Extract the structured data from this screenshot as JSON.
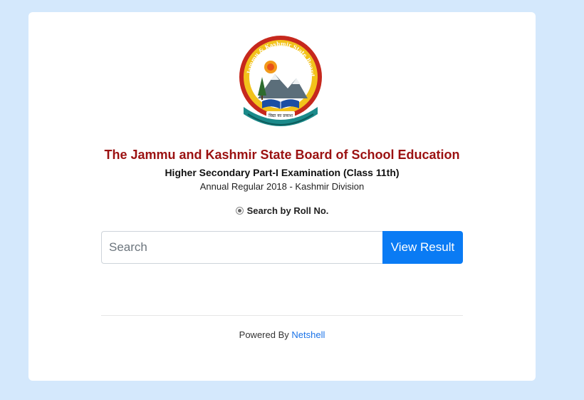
{
  "header": {
    "logo_text_top": "Jammu & Kashmir State Board Of School Education",
    "logo_motto": "विद्या का प्रकाश",
    "title": "The Jammu and Kashmir State Board of School Education",
    "exam": "Higher Secondary Part-I Examination (Class 11th)",
    "session": "Annual Regular 2018 - Kashmir Division"
  },
  "search": {
    "radio_label": "Search by Roll No.",
    "placeholder": "Search",
    "value": "",
    "button_label": "View Result"
  },
  "footer": {
    "powered_by": "Powered By",
    "link_text": "Netshell"
  },
  "colors": {
    "background": "#d4e8fc",
    "title": "#9b1111",
    "button": "#0a7bf4",
    "link": "#1a73e8"
  }
}
